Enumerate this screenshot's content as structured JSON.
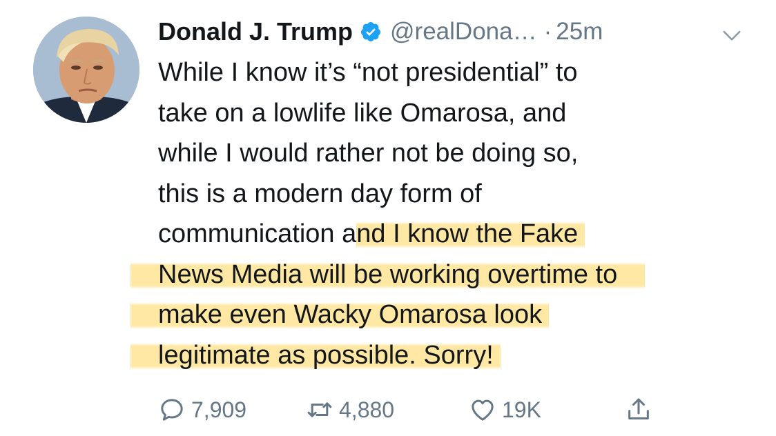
{
  "tweet": {
    "author_name": "Donald J. Trump",
    "handle": "@realDona…",
    "separator": "·",
    "time": "25m",
    "text_lines": [
      "While I know it’s “not presidential” to",
      "take on a lowlife like Omarosa, and",
      "while I would rather not be doing so,",
      "this is a modern day form of"
    ],
    "line5_plain": "communication a",
    "line5_highlight": "nd I know the Fake",
    "line6": "News Media will be working overtime to",
    "line7": "make even Wacky Omarosa look",
    "line8": "legitimate as possible. Sorry!",
    "highlight_color": "#FFD65A"
  },
  "actions": {
    "reply_count": "7,909",
    "retweet_count": "4,880",
    "like_count": "19K"
  },
  "icons": {
    "reply": "reply-icon",
    "retweet": "retweet-icon",
    "like": "heart-icon",
    "share": "share-icon",
    "verified": "verified-badge-icon",
    "more": "chevron-down-icon"
  }
}
